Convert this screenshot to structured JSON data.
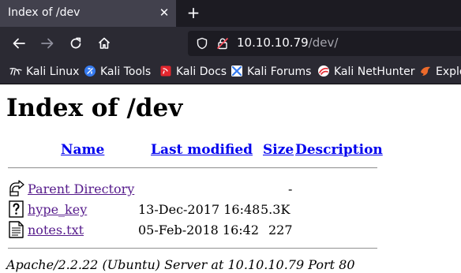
{
  "tab": {
    "title": "Index of /dev",
    "close_glyph": "✕",
    "new_tab_glyph": "+"
  },
  "navigation": {
    "back": "back-icon",
    "forward": "forward-icon",
    "reload": "reload-icon",
    "home": "home-icon"
  },
  "urlbar": {
    "host": "10.10.10.79",
    "path": "/dev/"
  },
  "bookmarks": [
    {
      "label": "Kali Linux",
      "icon": "kali-dragon-icon"
    },
    {
      "label": "Kali Tools",
      "icon": "kali-tools-icon"
    },
    {
      "label": "Kali Docs",
      "icon": "kali-docs-icon"
    },
    {
      "label": "Kali Forums",
      "icon": "kali-forums-icon"
    },
    {
      "label": "Kali NetHunter",
      "icon": "kali-nethunter-icon"
    },
    {
      "label": "Exploit-DB",
      "icon": "exploit-db-icon"
    }
  ],
  "page": {
    "title": "Index of /dev",
    "columns": {
      "name": "Name",
      "last_modified": "Last modified",
      "size": "Size",
      "description": "Description"
    },
    "rows": [
      {
        "name": "Parent Directory",
        "modified": "",
        "size": "-",
        "icon": "back-folder-icon"
      },
      {
        "name": "hype_key",
        "modified": "13-Dec-2017 16:48",
        "size": "5.3K",
        "icon": "unknown-file-icon"
      },
      {
        "name": "notes.txt",
        "modified": "05-Feb-2018 16:42",
        "size": "227",
        "icon": "text-file-icon"
      }
    ],
    "footer": "Apache/2.2.22 (Ubuntu) Server at 10.10.10.79 Port 80"
  },
  "colors": {
    "tabbar_bg": "#1c1b22",
    "toolbar_bg": "#2b2a33",
    "link_visited": "#551a8b",
    "link": "#0000ee"
  }
}
